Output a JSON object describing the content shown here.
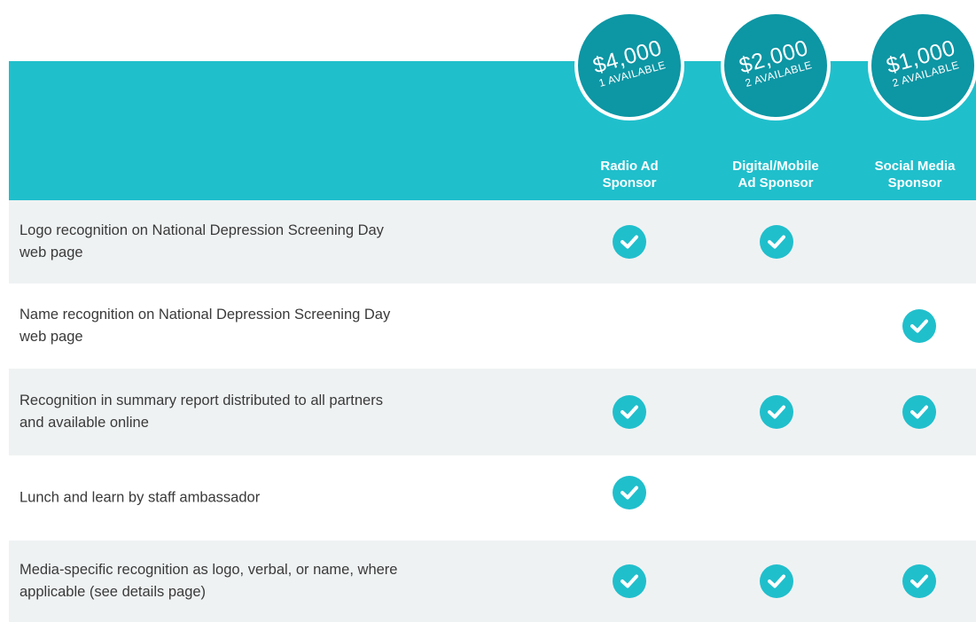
{
  "tiers": [
    {
      "price": "$4,000",
      "availability": "1 AVAILABLE",
      "name_line1": "Radio Ad",
      "name_line2": "Sponsor"
    },
    {
      "price": "$2,000",
      "availability": "2 AVAILABLE",
      "name_line1": "Digital/Mobile",
      "name_line2": "Ad Sponsor"
    },
    {
      "price": "$1,000",
      "availability": "2 AVAILABLE",
      "name_line1": "Social Media",
      "name_line2": "Sponsor"
    }
  ],
  "benefits": [
    {
      "label_line1": "Logo recognition on National Depression Screening Day",
      "label_line2": "web page",
      "included": [
        true,
        true,
        false
      ]
    },
    {
      "label_line1": "Name recognition on National Depression Screening Day",
      "label_line2": "web page",
      "included": [
        false,
        false,
        true
      ]
    },
    {
      "label_line1": "Recognition in summary report distributed to all partners",
      "label_line2": "and available online",
      "included": [
        true,
        true,
        true
      ]
    },
    {
      "label_line1": "Lunch and learn by staff ambassador",
      "label_line2": "",
      "included": [
        true,
        false,
        false
      ]
    },
    {
      "label_line1": "Media-specific recognition as logo, verbal, or name, where",
      "label_line2": "applicable (see details page)",
      "included": [
        true,
        true,
        true
      ]
    }
  ],
  "icons": {
    "check": "check-circle-icon"
  },
  "colors": {
    "header": "#20bfcc",
    "badge": "#0d96a4",
    "row_shade": "#eff2f3",
    "text": "#3a3a3a"
  }
}
